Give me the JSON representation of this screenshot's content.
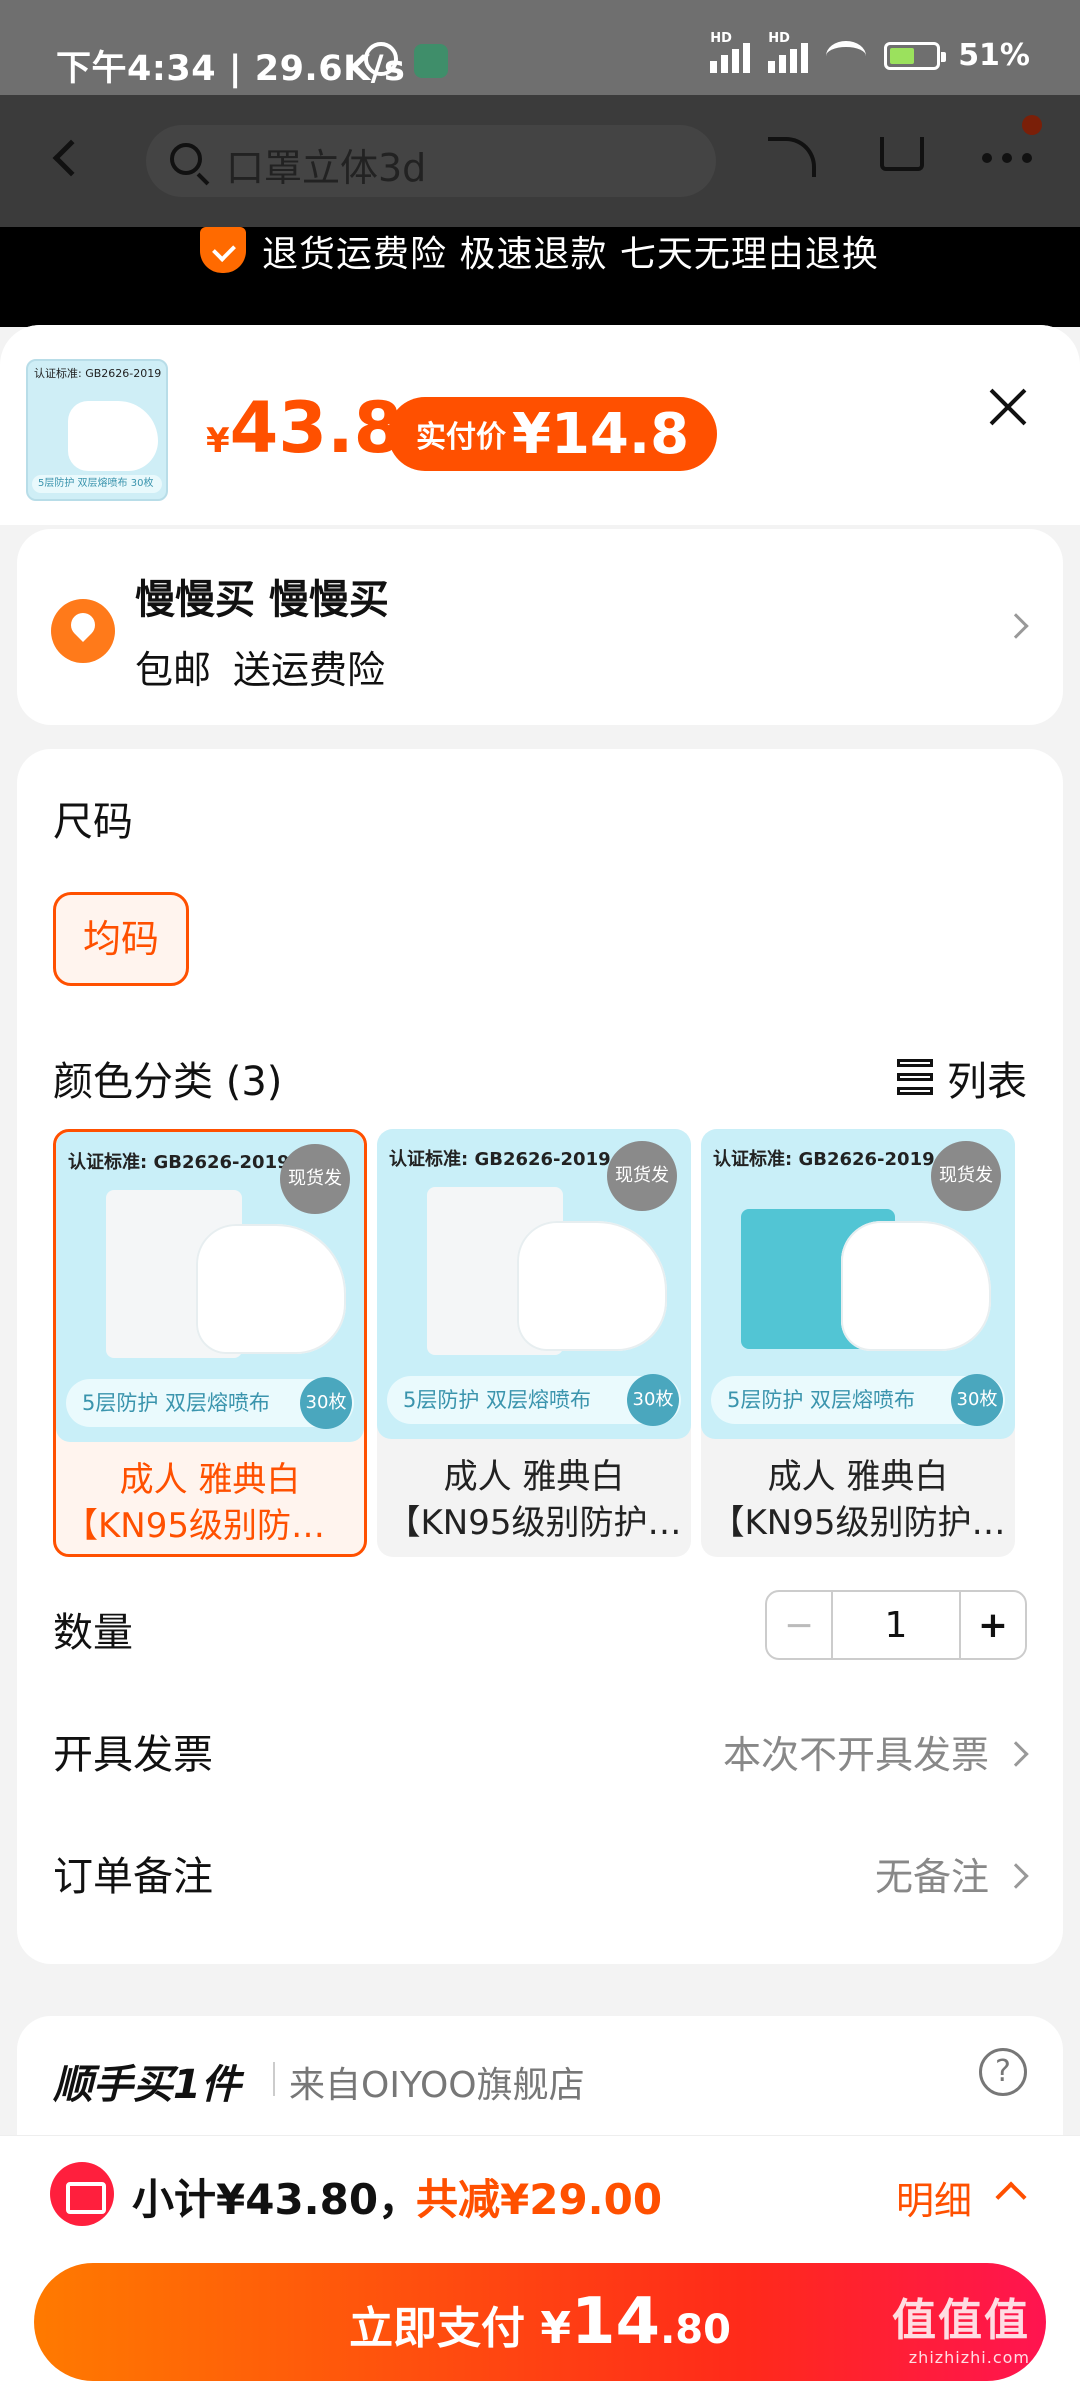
{
  "status_bar": {
    "time": "下午4:34",
    "speed": "| 29.6K/s",
    "battery": "51%",
    "hd1": "HD",
    "hd2": "HD"
  },
  "header": {
    "search_placeholder": "口罩立体3d"
  },
  "promo": {
    "text": "退货运费险 极速退款 七天无理由退换"
  },
  "product": {
    "price_currency": "¥",
    "price": "43.8",
    "pay_label": "实付价",
    "pay_price": "¥14.8",
    "thumb_cert": "认证标准: GB2626-2019",
    "thumb_strip": "5层防护 双层熔喷布 30枚"
  },
  "address": {
    "name": "慢慢买 慢慢买",
    "tags": [
      "包邮",
      "送运费险"
    ]
  },
  "spec": {
    "size_title": "尺码",
    "size_option": "均码",
    "color_title": "颜色分类 (3)",
    "list_label": "列表",
    "variants": [
      {
        "cert": "认证标准: GB2626-2019",
        "badge": "现货发",
        "strip": "5层防护 双层熔喷布",
        "count": "30枚",
        "line1": "成人  雅典白",
        "line2": "【KN95级别防护…",
        "selected": true
      },
      {
        "cert": "认证标准: GB2626-2019",
        "badge": "现货发",
        "strip": "5层防护 双层熔喷布",
        "count": "30枚",
        "line1": "成人  雅典白",
        "line2": "【KN95级别防护…",
        "selected": false
      },
      {
        "cert": "认证标准: GB2626-2019",
        "badge": "现货发",
        "strip": "5层防护 双层熔喷布",
        "count": "30枚",
        "line1": "成人  雅典白",
        "line2": "【KN95级别防护…",
        "selected": false
      }
    ],
    "qty_label": "数量",
    "qty_minus": "−",
    "qty_value": "1",
    "qty_plus": "+",
    "invoice_label": "开具发票",
    "invoice_value": "本次不开具发票",
    "note_label": "订单备注",
    "note_value": "无备注"
  },
  "bundle": {
    "title": "顺手买1件",
    "from": "来自OIYOO旗舰店",
    "help": "?"
  },
  "bottom": {
    "subtotal": "小计¥43.80，",
    "discount": "共减¥29.00",
    "detail": "明细",
    "pay_label": "立即支付 ¥",
    "pay_int": "14",
    "pay_dec": ".80",
    "watermark": "值值值",
    "watermark_sub": "zhizhizhi.com"
  },
  "colors": {
    "accent": "#ff5000",
    "pay_gradient_start": "#ff7a00",
    "pay_gradient_end": "#ff1450"
  }
}
